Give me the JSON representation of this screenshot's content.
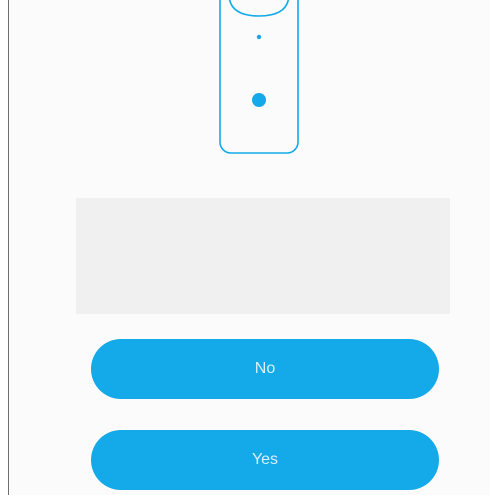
{
  "illustration": {
    "icon": "phone-device-icon",
    "accent_color": "#14a9e8"
  },
  "message": {
    "text": ""
  },
  "buttons": {
    "no_label": "No",
    "yes_label": "Yes"
  },
  "colors": {
    "button_bg": "#14a9e8",
    "button_text": "#d8f1fc",
    "message_bg": "#f0f0f0"
  }
}
